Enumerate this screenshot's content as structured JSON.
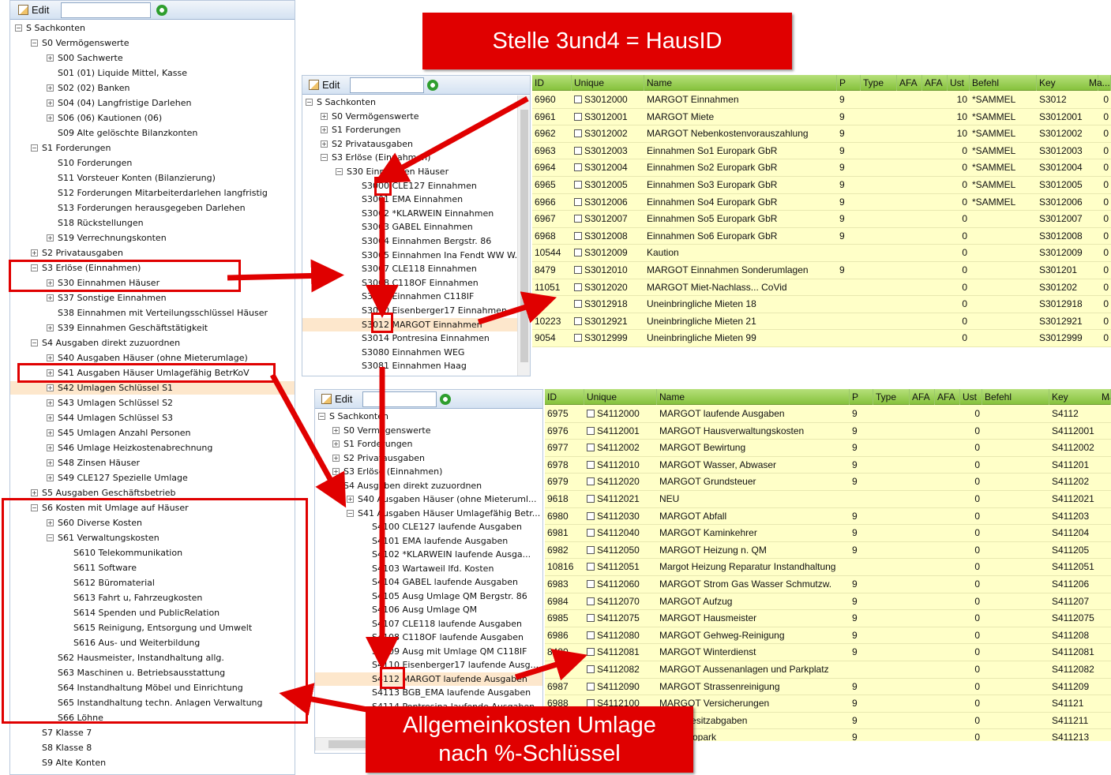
{
  "toolbar": {
    "edit_label": "Edit"
  },
  "left_tree": [
    {
      "t": "S Sachkonten",
      "l": 0,
      "e": "-"
    },
    {
      "t": "S0 Vermögenswerte",
      "l": 1,
      "e": "-"
    },
    {
      "t": "S00 Sachwerte",
      "l": 2,
      "e": "+"
    },
    {
      "t": "S01  (01) Liquide Mittel, Kasse",
      "l": 2,
      "e": ""
    },
    {
      "t": "S02  (02) Banken",
      "l": 2,
      "e": "+"
    },
    {
      "t": "S04  (04) Langfristige Darlehen",
      "l": 2,
      "e": "+"
    },
    {
      "t": "S06  (06) Kautionen (06)",
      "l": 2,
      "e": "+"
    },
    {
      "t": "S09 Alte gelöschte Bilanzkonten",
      "l": 2,
      "e": ""
    },
    {
      "t": "S1 Forderungen",
      "l": 1,
      "e": "-"
    },
    {
      "t": "S10 Forderungen",
      "l": 2,
      "e": ""
    },
    {
      "t": "S11 Vorsteuer Konten (Bilanzierung)",
      "l": 2,
      "e": ""
    },
    {
      "t": "S12 Forderungen Mitarbeiterdarlehen langfristig",
      "l": 2,
      "e": ""
    },
    {
      "t": "S13 Forderungen herausgegeben Darlehen",
      "l": 2,
      "e": ""
    },
    {
      "t": "S18 Rückstellungen",
      "l": 2,
      "e": ""
    },
    {
      "t": "S19 Verrechnungskonten",
      "l": 2,
      "e": "+"
    },
    {
      "t": "S2 Privatausgaben",
      "l": 1,
      "e": "+"
    },
    {
      "t": "S3 Erlöse (Einnahmen)",
      "l": 1,
      "e": "-"
    },
    {
      "t": "S30 Einnahmen Häuser",
      "l": 2,
      "e": "+"
    },
    {
      "t": "S37 Sonstige Einnahmen",
      "l": 2,
      "e": "+"
    },
    {
      "t": "S38 Einnahmen mit Verteilungsschlüssel Häuser",
      "l": 2,
      "e": ""
    },
    {
      "t": "S39 Einnahmen Geschäftstätigkeit",
      "l": 2,
      "e": "+"
    },
    {
      "t": "S4 Ausgaben direkt zuzuordnen",
      "l": 1,
      "e": "-"
    },
    {
      "t": "S40 Ausgaben Häuser (ohne Mieterumlage)",
      "l": 2,
      "e": "+"
    },
    {
      "t": "S41 Ausgaben Häuser Umlagefähig BetrKoV",
      "l": 2,
      "e": "+"
    },
    {
      "t": "S42 Umlagen Schlüssel S1",
      "l": 2,
      "e": "+",
      "sel": true
    },
    {
      "t": "S43 Umlagen Schlüssel S2",
      "l": 2,
      "e": "+"
    },
    {
      "t": "S44 Umlagen Schlüssel S3",
      "l": 2,
      "e": "+"
    },
    {
      "t": "S45 Umlagen Anzahl Personen",
      "l": 2,
      "e": "+"
    },
    {
      "t": "S46 Umlage Heizkostenabrechnung",
      "l": 2,
      "e": "+"
    },
    {
      "t": "S48 Zinsen Häuser",
      "l": 2,
      "e": "+"
    },
    {
      "t": "S49 CLE127 Spezielle Umlage",
      "l": 2,
      "e": "+"
    },
    {
      "t": "S5 Ausgaben Geschäftsbetrieb",
      "l": 1,
      "e": "+"
    },
    {
      "t": "S6 Kosten mit Umlage auf Häuser",
      "l": 1,
      "e": "-"
    },
    {
      "t": "S60 Diverse Kosten",
      "l": 2,
      "e": "+"
    },
    {
      "t": "S61 Verwaltungskosten",
      "l": 2,
      "e": "-"
    },
    {
      "t": "S610 Telekommunikation",
      "l": 3,
      "e": ""
    },
    {
      "t": "S611 Software",
      "l": 3,
      "e": ""
    },
    {
      "t": "S612 Büromaterial",
      "l": 3,
      "e": ""
    },
    {
      "t": "S613 Fahrt u, Fahrzeugkosten",
      "l": 3,
      "e": ""
    },
    {
      "t": "S614 Spenden und PublicRelation",
      "l": 3,
      "e": ""
    },
    {
      "t": "S615 Reinigung, Entsorgung und Umwelt",
      "l": 3,
      "e": ""
    },
    {
      "t": "S616 Aus- und Weiterbildung",
      "l": 3,
      "e": ""
    },
    {
      "t": "S62 Hausmeister, Instandhaltung allg.",
      "l": 2,
      "e": ""
    },
    {
      "t": "S63 Maschinen u. Betriebsausstattung",
      "l": 2,
      "e": ""
    },
    {
      "t": "S64 Instandhaltung Möbel und Einrichtung",
      "l": 2,
      "e": ""
    },
    {
      "t": "S65 Instandhaltung techn. Anlagen Verwaltung",
      "l": 2,
      "e": ""
    },
    {
      "t": "S66 Löhne",
      "l": 2,
      "e": ""
    },
    {
      "t": "S7 Klasse 7",
      "l": 1,
      "e": ""
    },
    {
      "t": "S8 Klasse 8",
      "l": 1,
      "e": ""
    },
    {
      "t": "S9 Alte Konten",
      "l": 1,
      "e": ""
    }
  ],
  "mid_tree": [
    {
      "t": "S Sachkonten",
      "l": 0,
      "e": "-"
    },
    {
      "t": "S0 Vermögenswerte",
      "l": 1,
      "e": "+"
    },
    {
      "t": "S1 Forderungen",
      "l": 1,
      "e": "+"
    },
    {
      "t": "S2 Privatausgaben",
      "l": 1,
      "e": "+"
    },
    {
      "t": "S3 Erlöse (Einnahmen)",
      "l": 1,
      "e": "-"
    },
    {
      "t": "S30 Einnahmen Häuser",
      "l": 2,
      "e": "-"
    },
    {
      "t": "S3000 CLE127 Einnahmen",
      "l": 3,
      "e": ""
    },
    {
      "t": "S3001 EMA Einnahmen",
      "l": 3,
      "e": ""
    },
    {
      "t": "S3002 *KLARWEIN Einnahmen",
      "l": 3,
      "e": ""
    },
    {
      "t": "S3003 GABEL Einnahmen",
      "l": 3,
      "e": ""
    },
    {
      "t": "S3004 Einnahmen Bergstr. 86",
      "l": 3,
      "e": ""
    },
    {
      "t": "S3005 Einnahmen Ina Fendt WW W...",
      "l": 3,
      "e": ""
    },
    {
      "t": "S3007 CLE118 Einnahmen",
      "l": 3,
      "e": ""
    },
    {
      "t": "S3008 C118OF Einnahmen",
      "l": 3,
      "e": ""
    },
    {
      "t": "S3009 Einnahmen C118IF",
      "l": 3,
      "e": ""
    },
    {
      "t": "S3010 Eisenberger17 Einnahmen",
      "l": 3,
      "e": ""
    },
    {
      "t": "S3012 MARGOT Einnahmen",
      "l": 3,
      "e": "",
      "sel": true
    },
    {
      "t": "S3014 Pontresina Einnahmen",
      "l": 3,
      "e": ""
    },
    {
      "t": "S3080 Einnahmen WEG",
      "l": 3,
      "e": ""
    },
    {
      "t": "S3081 Einnahmen Haag",
      "l": 3,
      "e": ""
    }
  ],
  "bot_tree": [
    {
      "t": "S Sachkonten",
      "l": 0,
      "e": "-"
    },
    {
      "t": "S0 Vermögenswerte",
      "l": 1,
      "e": "+"
    },
    {
      "t": "S1 Forderungen",
      "l": 1,
      "e": "+"
    },
    {
      "t": "S2 Privatausgaben",
      "l": 1,
      "e": "+"
    },
    {
      "t": "S3 Erlöse (Einnahmen)",
      "l": 1,
      "e": "+"
    },
    {
      "t": "S4 Ausgaben direkt zuzuordnen",
      "l": 1,
      "e": "-"
    },
    {
      "t": "S40 Ausgaben Häuser (ohne Mieteruml...",
      "l": 2,
      "e": "+"
    },
    {
      "t": "S41 Ausgaben Häuser Umlagefähig Betr...",
      "l": 2,
      "e": "-"
    },
    {
      "t": "S4100 CLE127 laufende Ausgaben",
      "l": 3,
      "e": ""
    },
    {
      "t": "S4101 EMA laufende Ausgaben",
      "l": 3,
      "e": ""
    },
    {
      "t": "S4102 *KLARWEIN laufende Ausga...",
      "l": 3,
      "e": ""
    },
    {
      "t": "S4103 Wartaweil lfd. Kosten",
      "l": 3,
      "e": ""
    },
    {
      "t": "S4104 GABEL laufende Ausgaben",
      "l": 3,
      "e": ""
    },
    {
      "t": "S4105 Ausg Umlage QM Bergstr. 86",
      "l": 3,
      "e": ""
    },
    {
      "t": "S4106 Ausg Umlage QM",
      "l": 3,
      "e": ""
    },
    {
      "t": "S4107 CLE118 laufende Ausgaben",
      "l": 3,
      "e": ""
    },
    {
      "t": "S4108 C118OF laufende Ausgaben",
      "l": 3,
      "e": ""
    },
    {
      "t": "S4109 Ausg mit Umlage QM C118IF",
      "l": 3,
      "e": ""
    },
    {
      "t": "S4110 Eisenberger17 laufende Ausg...",
      "l": 3,
      "e": ""
    },
    {
      "t": "S4112 MARGOT laufende Ausgaben",
      "l": 3,
      "e": "",
      "sel": true
    },
    {
      "t": "S4113 BGB_EMA laufende Ausgaben",
      "l": 3,
      "e": ""
    },
    {
      "t": "S4114 Pontresina laufende Ausgaben",
      "l": 3,
      "e": ""
    }
  ],
  "grid_top": {
    "headers": [
      "ID",
      "Unique",
      "Name",
      "P",
      "Type",
      "AFA",
      "AFA",
      "Ust",
      "Befehl",
      "Key",
      "Ma..."
    ],
    "rows": [
      [
        "6960",
        "S3012000",
        "MARGOT Einnahmen",
        "9",
        "",
        "",
        "",
        "10",
        "*SAMMEL",
        "S3012",
        "0"
      ],
      [
        "6961",
        "S3012001",
        "MARGOT Miete",
        "9",
        "",
        "",
        "",
        "10",
        "*SAMMEL",
        "S3012001",
        "0"
      ],
      [
        "6962",
        "S3012002",
        "MARGOT Nebenkostenvorauszahlung",
        "9",
        "",
        "",
        "",
        "10",
        "*SAMMEL",
        "S3012002",
        "0"
      ],
      [
        "6963",
        "S3012003",
        "Einnahmen So1 Europark GbR",
        "9",
        "",
        "",
        "",
        "0",
        "*SAMMEL",
        "S3012003",
        "0"
      ],
      [
        "6964",
        "S3012004",
        "Einnahmen So2 Europark GbR",
        "9",
        "",
        "",
        "",
        "0",
        "*SAMMEL",
        "S3012004",
        "0"
      ],
      [
        "6965",
        "S3012005",
        "Einnahmen So3 Europark GbR",
        "9",
        "",
        "",
        "",
        "0",
        "*SAMMEL",
        "S3012005",
        "0"
      ],
      [
        "6966",
        "S3012006",
        "Einnahmen So4 Europark GbR",
        "9",
        "",
        "",
        "",
        "0",
        "*SAMMEL",
        "S3012006",
        "0"
      ],
      [
        "6967",
        "S3012007",
        "Einnahmen So5 Europark GbR",
        "9",
        "",
        "",
        "",
        "0",
        "",
        "S3012007",
        "0"
      ],
      [
        "6968",
        "S3012008",
        "Einnahmen So6 Europark GbR",
        "9",
        "",
        "",
        "",
        "0",
        "",
        "S3012008",
        "0"
      ],
      [
        "10544",
        "S3012009",
        "Kaution",
        "",
        "",
        "",
        "",
        "0",
        "",
        "S3012009",
        "0"
      ],
      [
        "8479",
        "S3012010",
        "MARGOT Einnahmen Sonderumlagen",
        "9",
        "",
        "",
        "",
        "0",
        "",
        "S301201",
        "0"
      ],
      [
        "11051",
        "S3012020",
        "MARGOT Miet-Nachlass... CoVid",
        "",
        "",
        "",
        "",
        "0",
        "",
        "S301202",
        "0"
      ],
      [
        "",
        "S3012918",
        "Uneinbringliche Mieten 18",
        "",
        "",
        "",
        "",
        "0",
        "",
        "S3012918",
        "0"
      ],
      [
        "10223",
        "S3012921",
        "Uneinbringliche Mieten 21",
        "",
        "",
        "",
        "",
        "0",
        "",
        "S3012921",
        "0"
      ],
      [
        "9054",
        "S3012999",
        "Uneinbringliche Mieten 99",
        "",
        "",
        "",
        "",
        "0",
        "",
        "S3012999",
        "0"
      ]
    ]
  },
  "grid_bot": {
    "headers": [
      "ID",
      "Unique",
      "Name",
      "P",
      "Type",
      "AFA",
      "AFA",
      "Ust",
      "Befehl",
      "Key",
      "Ma"
    ],
    "rows": [
      [
        "6975",
        "S4112000",
        "MARGOT laufende Ausgaben",
        "9",
        "",
        "",
        "",
        "0",
        "",
        "S4112",
        ""
      ],
      [
        "6976",
        "S4112001",
        "MARGOT Hausverwaltungskosten",
        "9",
        "",
        "",
        "",
        "0",
        "",
        "S4112001",
        ""
      ],
      [
        "6977",
        "S4112002",
        "MARGOT Bewirtung",
        "9",
        "",
        "",
        "",
        "0",
        "",
        "S4112002",
        ""
      ],
      [
        "6978",
        "S4112010",
        "MARGOT Wasser, Abwaser",
        "9",
        "",
        "",
        "",
        "0",
        "",
        "S411201",
        ""
      ],
      [
        "6979",
        "S4112020",
        "MARGOT Grundsteuer",
        "9",
        "",
        "",
        "",
        "0",
        "",
        "S411202",
        ""
      ],
      [
        "9618",
        "S4112021",
        "NEU",
        "",
        "",
        "",
        "",
        "0",
        "",
        "S4112021",
        ""
      ],
      [
        "6980",
        "S4112030",
        "MARGOT Abfall",
        "9",
        "",
        "",
        "",
        "0",
        "",
        "S411203",
        ""
      ],
      [
        "6981",
        "S4112040",
        "MARGOT Kaminkehrer",
        "9",
        "",
        "",
        "",
        "0",
        "",
        "S411204",
        ""
      ],
      [
        "6982",
        "S4112050",
        "MARGOT Heizung n. QM",
        "9",
        "",
        "",
        "",
        "0",
        "",
        "S411205",
        ""
      ],
      [
        "10816",
        "S4112051",
        "Margot Heizung Reparatur Instandhaltung",
        "",
        "",
        "",
        "",
        "0",
        "",
        "S4112051",
        ""
      ],
      [
        "6983",
        "S4112060",
        "MARGOT Strom Gas Wasser Schmutzw.",
        "9",
        "",
        "",
        "",
        "0",
        "",
        "S411206",
        ""
      ],
      [
        "6984",
        "S4112070",
        "MARGOT Aufzug",
        "9",
        "",
        "",
        "",
        "0",
        "",
        "S411207",
        ""
      ],
      [
        "6985",
        "S4112075",
        "MARGOT Hausmeister",
        "9",
        "",
        "",
        "",
        "0",
        "",
        "S4112075",
        ""
      ],
      [
        "6986",
        "S4112080",
        "MARGOT Gehweg-Reinigung",
        "9",
        "",
        "",
        "",
        "0",
        "",
        "S411208",
        ""
      ],
      [
        "8490",
        "S4112081",
        "MARGOT Winterdienst",
        "9",
        "",
        "",
        "",
        "0",
        "",
        "S4112081",
        ""
      ],
      [
        "",
        "S4112082",
        "MARGOT Aussenanlagen und Parkplatz",
        "",
        "",
        "",
        "",
        "0",
        "",
        "S4112082",
        ""
      ],
      [
        "6987",
        "S4112090",
        "MARGOT Strassenreinigung",
        "9",
        "",
        "",
        "",
        "0",
        "",
        "S411209",
        ""
      ],
      [
        "6988",
        "S4112100",
        "MARGOT Versicherungen",
        "9",
        "",
        "",
        "",
        "0",
        "",
        "S41121",
        ""
      ],
      [
        "",
        "",
        "Grundbesitzabgaben",
        "9",
        "",
        "",
        "",
        "0",
        "",
        "S411211",
        ""
      ],
      [
        "",
        "",
        "ster Europark",
        "9",
        "",
        "",
        "",
        "0",
        "",
        "S411213",
        ""
      ]
    ]
  },
  "callouts": {
    "top": "Stelle 3und4 = HausID",
    "bottom_line1": "Allgemeinkosten Umlage",
    "bottom_line2": "nach %-Schlüssel"
  },
  "colors": {
    "accent_red": "#e00000",
    "grid_header": "#86c23d",
    "grid_bg": "#ffffc8",
    "selection": "#fde7cc"
  }
}
